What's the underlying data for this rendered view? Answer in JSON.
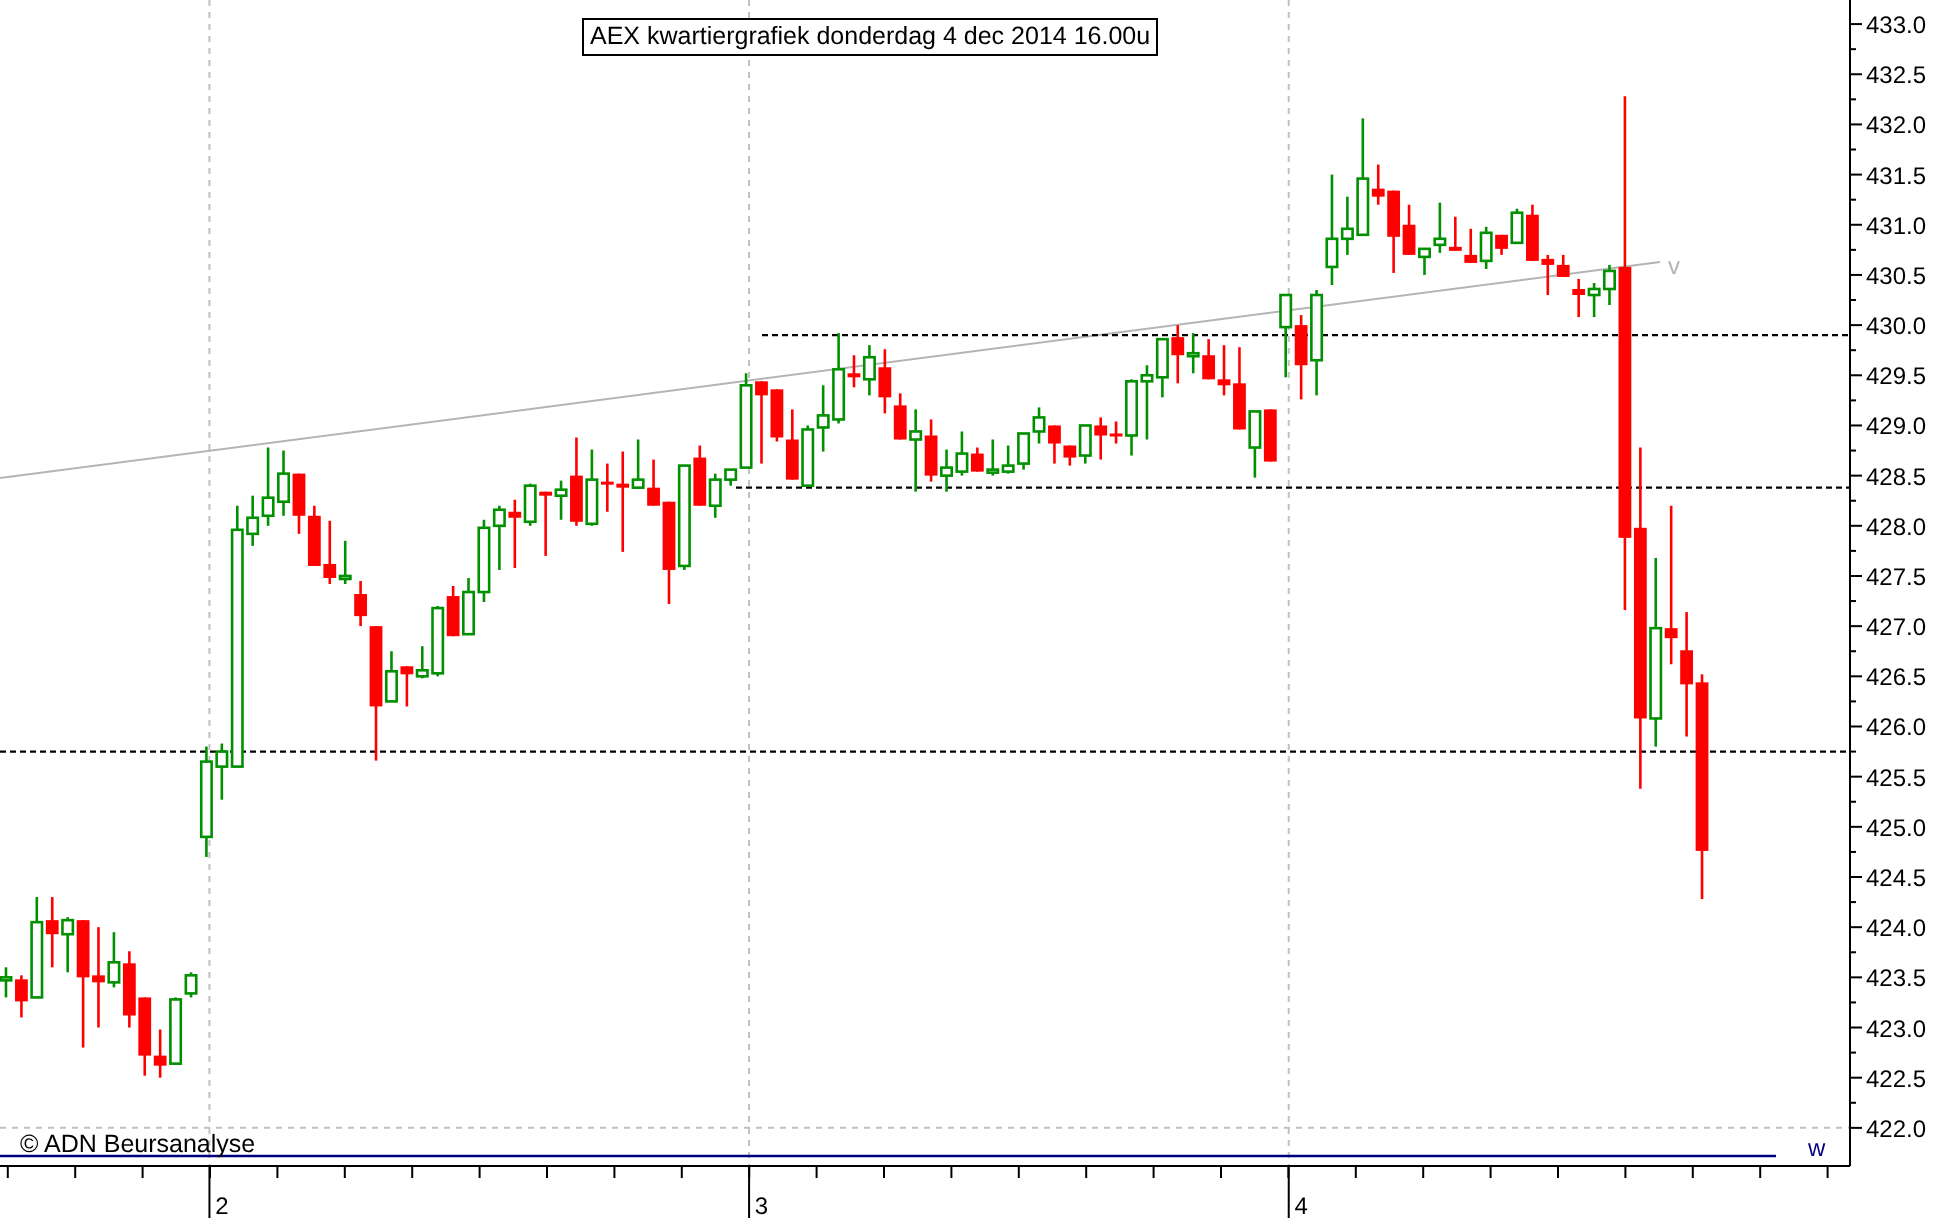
{
  "chart": {
    "copyright": "© ADN Beursanalyse",
    "marker": "w",
    "trend_label": "v",
    "chart_data": {
      "type": "candlestick",
      "title": "AEX kwartiergrafiek donderdag 4 dec 2014 16.00u",
      "xlim": [
        1.5889,
        5.0171
      ],
      "ylim": [
        421.62,
        433.24
      ],
      "x": [
        1.6,
        1.6286,
        1.6571,
        1.6857,
        1.7143,
        1.7429,
        1.7714,
        1.8,
        1.8286,
        1.8571,
        1.8857,
        1.9143,
        1.9429,
        1.9714,
        2.0,
        2.0286,
        2.0571,
        2.0857,
        2.1143,
        2.1429,
        2.1714,
        2.2,
        2.2286,
        2.2571,
        2.2857,
        2.3143,
        2.3429,
        2.3714,
        2.4,
        2.4286,
        2.4571,
        2.4857,
        2.5143,
        2.5429,
        2.5714,
        2.6,
        2.6286,
        2.6571,
        2.6857,
        2.7143,
        2.7429,
        2.7714,
        2.8,
        2.8286,
        2.8571,
        2.8857,
        2.9143,
        2.9429,
        2.9714,
        3.0,
        3.0286,
        3.0571,
        3.0857,
        3.1143,
        3.1429,
        3.1714,
        3.2,
        3.2286,
        3.2571,
        3.2857,
        3.3143,
        3.3429,
        3.3714,
        3.4,
        3.4286,
        3.4571,
        3.4857,
        3.5143,
        3.5429,
        3.5714,
        3.6,
        3.6286,
        3.6571,
        3.6857,
        3.7143,
        3.7429,
        3.7714,
        3.8,
        3.8286,
        3.8571,
        3.8857,
        3.9143,
        3.9429,
        3.9714,
        4.0,
        4.0286,
        4.0571,
        4.0857,
        4.1143,
        4.1429,
        4.1714,
        4.2,
        4.2286,
        4.2571,
        4.2857,
        4.3143,
        4.3429,
        4.3714,
        4.4,
        4.4286,
        4.4571,
        4.4857,
        4.5143,
        4.5429,
        4.5714,
        4.6,
        4.6286,
        4.6571,
        4.6857,
        4.7143,
        4.7429
      ],
      "xticks": [
        2,
        3,
        4
      ],
      "yticks": [
        {
          "value": 422,
          "label": "422.0"
        },
        {
          "value": 422.5,
          "label": "422.5"
        },
        {
          "value": 423,
          "label": "423.0"
        },
        {
          "value": 423.5,
          "label": "423.5"
        },
        {
          "value": 424,
          "label": "424.0"
        },
        {
          "value": 424.5,
          "label": "424.5"
        },
        {
          "value": 425,
          "label": "425.0"
        },
        {
          "value": 425.5,
          "label": "425.5"
        },
        {
          "value": 426,
          "label": "426.0"
        },
        {
          "value": 426.5,
          "label": "426.5"
        },
        {
          "value": 427,
          "label": "427.0"
        },
        {
          "value": 427.5,
          "label": "427.5"
        },
        {
          "value": 428,
          "label": "428.0"
        },
        {
          "value": 428.5,
          "label": "428.5"
        },
        {
          "value": 429,
          "label": "429.0"
        },
        {
          "value": 429.5,
          "label": "429.5"
        },
        {
          "value": 430,
          "label": "430.0"
        },
        {
          "value": 430.5,
          "label": "430.5"
        },
        {
          "value": 431,
          "label": "431.0"
        },
        {
          "value": 431.5,
          "label": "431.5"
        },
        {
          "value": 432,
          "label": "432.0"
        },
        {
          "value": 432.5,
          "label": "432.5"
        },
        {
          "value": 433,
          "label": "433.0"
        }
      ],
      "ohlc": [
        [
          423.5,
          423.6,
          423.3,
          423.5
        ],
        [
          423.48,
          423.52,
          423.1,
          423.26
        ],
        [
          423.3,
          424.3,
          423.3,
          424.05
        ],
        [
          424.07,
          424.3,
          423.6,
          423.93
        ],
        [
          423.93,
          424.1,
          423.55,
          424.07
        ],
        [
          424.07,
          424.07,
          422.8,
          423.5
        ],
        [
          423.52,
          424.0,
          423.0,
          423.45
        ],
        [
          423.45,
          423.95,
          423.4,
          423.65
        ],
        [
          423.64,
          423.76,
          423.0,
          423.12
        ],
        [
          423.3,
          423.3,
          422.52,
          422.72
        ],
        [
          422.72,
          422.98,
          422.5,
          422.62
        ],
        [
          422.64,
          423.3,
          422.64,
          423.28
        ],
        [
          423.34,
          423.55,
          423.3,
          423.52
        ],
        [
          424.9,
          425.8,
          424.7,
          425.65
        ],
        [
          425.6,
          425.83,
          425.27,
          425.75
        ],
        [
          425.6,
          428.2,
          425.6,
          427.96
        ],
        [
          427.92,
          428.3,
          427.8,
          428.08
        ],
        [
          428.1,
          428.78,
          428.0,
          428.28
        ],
        [
          428.24,
          428.75,
          428.1,
          428.52
        ],
        [
          428.52,
          428.52,
          427.92,
          428.1
        ],
        [
          428.1,
          428.2,
          427.6,
          427.6
        ],
        [
          427.62,
          428.05,
          427.42,
          427.48
        ],
        [
          427.5,
          427.85,
          427.42,
          427.5
        ],
        [
          427.32,
          427.45,
          427.0,
          427.1
        ],
        [
          427.0,
          427.0,
          425.66,
          426.2
        ],
        [
          426.25,
          426.75,
          426.25,
          426.55
        ],
        [
          426.6,
          426.6,
          426.2,
          426.52
        ],
        [
          426.5,
          426.8,
          426.48,
          426.56
        ],
        [
          426.53,
          427.2,
          426.5,
          427.18
        ],
        [
          427.3,
          427.4,
          426.9,
          426.9
        ],
        [
          426.92,
          427.48,
          426.92,
          427.34
        ],
        [
          427.34,
          428.06,
          427.24,
          427.98
        ],
        [
          428.0,
          428.2,
          427.56,
          428.16
        ],
        [
          428.14,
          428.26,
          427.58,
          428.08
        ],
        [
          428.04,
          428.42,
          428.0,
          428.4
        ],
        [
          428.34,
          428.34,
          427.7,
          428.3
        ],
        [
          428.3,
          428.45,
          428.06,
          428.36
        ],
        [
          428.5,
          428.88,
          428.0,
          428.04
        ],
        [
          428.02,
          428.76,
          428.0,
          428.46
        ],
        [
          428.44,
          428.62,
          428.14,
          428.42
        ],
        [
          428.42,
          428.74,
          427.74,
          428.38
        ],
        [
          428.38,
          428.86,
          428.38,
          428.46
        ],
        [
          428.38,
          428.66,
          428.2,
          428.2
        ],
        [
          428.24,
          428.24,
          427.22,
          427.56
        ],
        [
          427.6,
          428.6,
          427.56,
          428.6
        ],
        [
          428.68,
          428.8,
          428.2,
          428.2
        ],
        [
          428.2,
          428.52,
          428.08,
          428.46
        ],
        [
          428.46,
          428.56,
          428.4,
          428.56
        ],
        [
          428.58,
          429.52,
          428.58,
          429.4
        ],
        [
          429.44,
          429.44,
          428.62,
          429.3
        ],
        [
          429.36,
          429.36,
          428.84,
          428.88
        ],
        [
          428.86,
          429.16,
          428.46,
          428.46
        ],
        [
          428.4,
          429.0,
          428.4,
          428.96
        ],
        [
          428.98,
          429.4,
          428.74,
          429.1
        ],
        [
          429.06,
          429.92,
          429.02,
          429.56
        ],
        [
          429.52,
          429.7,
          429.38,
          429.48
        ],
        [
          429.46,
          429.8,
          429.3,
          429.68
        ],
        [
          429.58,
          429.76,
          429.12,
          429.28
        ],
        [
          429.2,
          429.32,
          428.86,
          428.86
        ],
        [
          428.86,
          429.16,
          428.34,
          428.94
        ],
        [
          428.9,
          429.06,
          428.44,
          428.5
        ],
        [
          428.5,
          428.76,
          428.34,
          428.58
        ],
        [
          428.54,
          428.94,
          428.5,
          428.72
        ],
        [
          428.72,
          428.78,
          428.54,
          428.54
        ],
        [
          428.54,
          428.86,
          428.5,
          428.56
        ],
        [
          428.54,
          428.8,
          428.52,
          428.6
        ],
        [
          428.62,
          428.92,
          428.56,
          428.92
        ],
        [
          428.94,
          429.18,
          428.82,
          429.08
        ],
        [
          429.0,
          429.0,
          428.62,
          428.82
        ],
        [
          428.8,
          428.8,
          428.6,
          428.68
        ],
        [
          428.7,
          429.0,
          428.62,
          429.0
        ],
        [
          429.0,
          429.08,
          428.66,
          428.9
        ],
        [
          428.92,
          429.04,
          428.82,
          428.9
        ],
        [
          428.9,
          429.46,
          428.7,
          429.44
        ],
        [
          429.44,
          429.6,
          428.86,
          429.5
        ],
        [
          429.48,
          429.86,
          429.28,
          429.86
        ],
        [
          429.88,
          430.0,
          429.42,
          429.7
        ],
        [
          429.7,
          429.92,
          429.52,
          429.72
        ],
        [
          429.7,
          429.86,
          429.46,
          429.46
        ],
        [
          429.46,
          429.8,
          429.3,
          429.4
        ],
        [
          429.42,
          429.78,
          428.96,
          428.96
        ],
        [
          428.78,
          429.14,
          428.48,
          429.14
        ],
        [
          429.16,
          429.16,
          428.64,
          428.64
        ],
        [
          429.98,
          430.3,
          429.48,
          430.3
        ],
        [
          430.0,
          430.1,
          429.26,
          429.6
        ],
        [
          429.65,
          430.35,
          429.3,
          430.3
        ],
        [
          430.58,
          431.5,
          430.4,
          430.86
        ],
        [
          430.86,
          431.28,
          430.7,
          430.96
        ],
        [
          430.9,
          432.06,
          430.9,
          431.46
        ],
        [
          431.36,
          431.6,
          431.2,
          431.28
        ],
        [
          431.34,
          431.34,
          430.52,
          430.88
        ],
        [
          431.0,
          431.2,
          430.7,
          430.7
        ],
        [
          430.68,
          430.76,
          430.5,
          430.76
        ],
        [
          430.8,
          431.22,
          430.72,
          430.86
        ],
        [
          430.78,
          431.08,
          430.74,
          430.74
        ],
        [
          430.7,
          430.96,
          430.62,
          430.62
        ],
        [
          430.64,
          430.98,
          430.56,
          430.92
        ],
        [
          430.9,
          430.9,
          430.7,
          430.76
        ],
        [
          430.82,
          431.16,
          430.82,
          431.12
        ],
        [
          431.1,
          431.2,
          430.64,
          430.64
        ],
        [
          430.66,
          430.7,
          430.3,
          430.6
        ],
        [
          430.6,
          430.7,
          430.48,
          430.48
        ],
        [
          430.36,
          430.46,
          430.08,
          430.3
        ],
        [
          430.3,
          430.42,
          430.08,
          430.36
        ],
        [
          430.36,
          430.6,
          430.2,
          430.54
        ],
        [
          430.58,
          432.28,
          427.16,
          427.88
        ],
        [
          427.98,
          428.78,
          425.38,
          426.08
        ],
        [
          426.08,
          427.68,
          425.8,
          426.98
        ],
        [
          426.98,
          428.2,
          426.62,
          426.88
        ],
        [
          426.76,
          427.14,
          425.9,
          426.42
        ],
        [
          426.44,
          426.52,
          424.28,
          424.76
        ]
      ],
      "ref_lines": [
        {
          "axis": "y",
          "value": 429.9,
          "color": "#000000"
        },
        {
          "axis": "y",
          "value": 428.38,
          "color": "#000000"
        },
        {
          "axis": "y",
          "value": 425.75,
          "color": "#000000"
        },
        {
          "axis": "y",
          "value": 421.72,
          "color": "#000080"
        }
      ]
    }
  }
}
